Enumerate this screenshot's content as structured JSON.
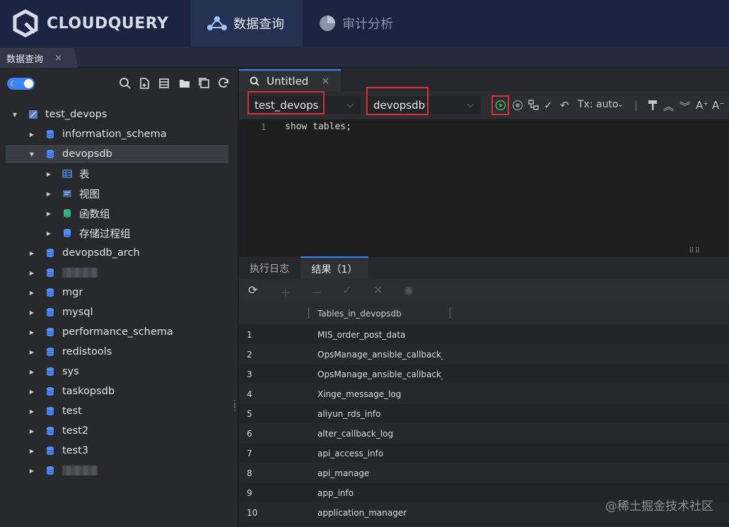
{
  "header": {
    "logo_text": "CLOUDQUERY",
    "nav": [
      {
        "label": "数据查询",
        "active": true
      },
      {
        "label": "审计分析",
        "active": false
      }
    ]
  },
  "doc_tab": {
    "label": "数据查询",
    "close": "×"
  },
  "sidebar": {
    "toolbar_icons": [
      "search-icon",
      "new-query-icon",
      "table-icon",
      "folder-icon",
      "copy-icon",
      "refresh-icon"
    ],
    "tree": [
      {
        "label": "test_devops",
        "level": 0,
        "expanded": true,
        "icon": "connection-icon"
      },
      {
        "label": "information_schema",
        "level": 1,
        "expanded": false,
        "icon": "database-icon"
      },
      {
        "label": "devopsdb",
        "level": 1,
        "expanded": true,
        "icon": "database-icon",
        "selected": true
      },
      {
        "label": "表",
        "level": 2,
        "expanded": false,
        "icon": "table-icon"
      },
      {
        "label": "视图",
        "level": 2,
        "expanded": false,
        "icon": "view-icon"
      },
      {
        "label": "函数组",
        "level": 2,
        "expanded": false,
        "icon": "function-icon"
      },
      {
        "label": "存储过程组",
        "level": 2,
        "expanded": false,
        "icon": "procedure-icon"
      },
      {
        "label": "devopsdb_arch",
        "level": 1,
        "expanded": false,
        "icon": "database-icon"
      },
      {
        "label": "",
        "level": 1,
        "expanded": false,
        "icon": "database-icon",
        "blurred": true
      },
      {
        "label": "mgr",
        "level": 1,
        "expanded": false,
        "icon": "database-icon"
      },
      {
        "label": "mysql",
        "level": 1,
        "expanded": false,
        "icon": "database-icon"
      },
      {
        "label": "performance_schema",
        "level": 1,
        "expanded": false,
        "icon": "database-icon"
      },
      {
        "label": "redistools",
        "level": 1,
        "expanded": false,
        "icon": "database-icon"
      },
      {
        "label": "sys",
        "level": 1,
        "expanded": false,
        "icon": "database-icon"
      },
      {
        "label": "taskopsdb",
        "level": 1,
        "expanded": false,
        "icon": "database-icon"
      },
      {
        "label": "test",
        "level": 1,
        "expanded": false,
        "icon": "database-icon"
      },
      {
        "label": "test2",
        "level": 1,
        "expanded": false,
        "icon": "database-icon"
      },
      {
        "label": "test3",
        "level": 1,
        "expanded": false,
        "icon": "database-icon"
      },
      {
        "label": "",
        "level": 1,
        "expanded": false,
        "icon": "database-icon",
        "blurred": true
      }
    ]
  },
  "editor": {
    "tab_label": "Untitled",
    "tab_close": "×",
    "connection_select": "test_devops",
    "database_select": "devopsdb",
    "tx_mode": "Tx: auto",
    "line_number": "1",
    "code": "show tables;"
  },
  "results": {
    "log_tab": "执行日志",
    "result_tab": "结果（1）",
    "column": "Tables_in_devopsdb",
    "rows": [
      {
        "n": "1",
        "v": "MIS_order_post_data"
      },
      {
        "n": "2",
        "v": "OpsManage_ansible_callback_mo"
      },
      {
        "n": "3",
        "v": "OpsManage_ansible_callback_pla"
      },
      {
        "n": "4",
        "v": "Xinge_message_log"
      },
      {
        "n": "5",
        "v": "aliyun_rds_info"
      },
      {
        "n": "6",
        "v": "alter_callback_log"
      },
      {
        "n": "7",
        "v": "api_access_info"
      },
      {
        "n": "8",
        "v": "api_manage"
      },
      {
        "n": "9",
        "v": "app_info"
      },
      {
        "n": "10",
        "v": "application_manager"
      }
    ]
  },
  "watermark": "@稀土掘金技术社区",
  "colors": {
    "accent": "#3b82f6",
    "highlight_box": "#e02b3b",
    "header_bg": "#1b2440"
  }
}
